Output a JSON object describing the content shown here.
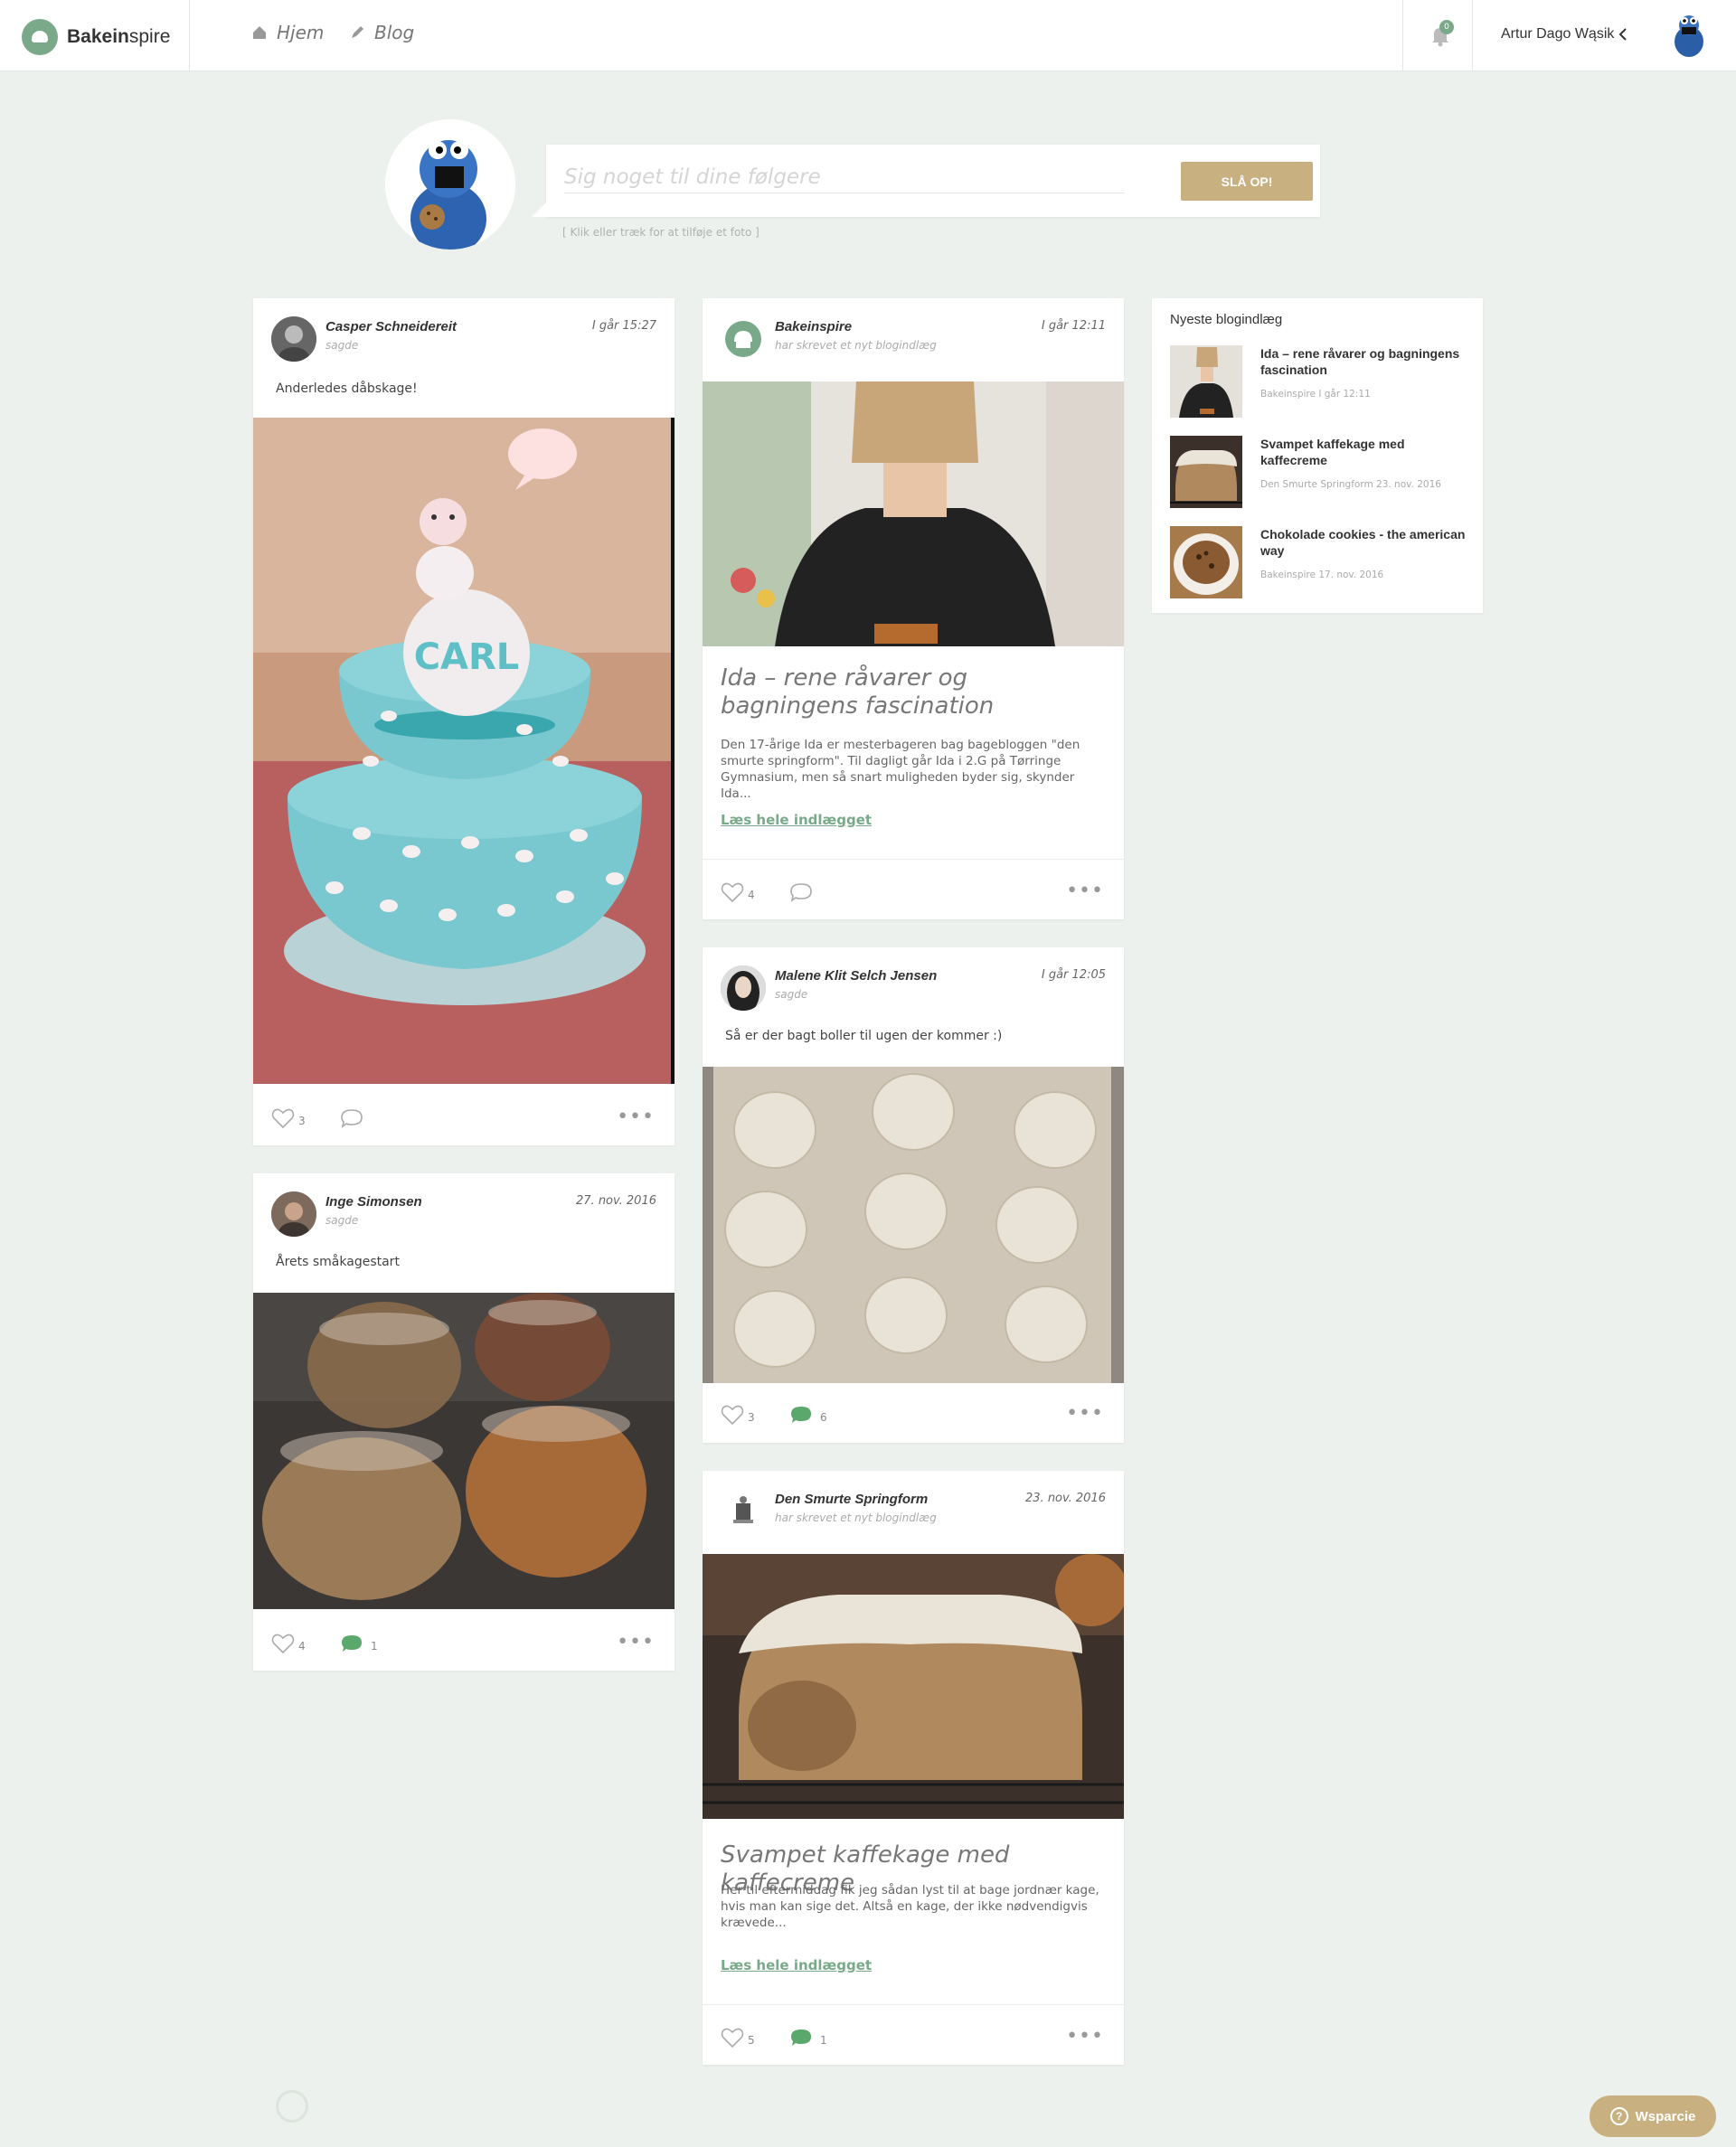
{
  "app": {
    "brand_bold": "Bakein",
    "brand_light": "spire"
  },
  "nav": {
    "home": "Hjem",
    "blog": "Blog"
  },
  "notifications": {
    "count": "0"
  },
  "user": {
    "name": "Artur Dago Wąsik"
  },
  "composer": {
    "placeholder": "Sig noget til dine følgere",
    "button": "SLÅ OP!",
    "hint": "[ Klik eller træk for at tilføje et foto ]"
  },
  "posts": [
    {
      "author": "Casper Schneidereit",
      "action": "sagde",
      "time": "I går 15:27",
      "text": "Anderledes dåbskage!",
      "likes": "3",
      "comments": ""
    },
    {
      "author": "Inge Simonsen",
      "action": "sagde",
      "time": "27. nov. 2016",
      "text": "Årets småkagestart",
      "likes": "4",
      "comments": "1"
    },
    {
      "author": "Bakeinspire",
      "action": "har skrevet et nyt blogindlæg",
      "time": "I går 12:11",
      "title": "Ida – rene råvarer og bagningens fascination",
      "excerpt": "Den 17-årige Ida er mesterbageren bag bagebloggen \"den smurte springform\". Til dagligt går Ida i 2.G på Tørringe Gymnasium, men så snart muligheden byder sig, skynder Ida...",
      "read_more": "Læs hele indlægget",
      "likes": "4",
      "comments": ""
    },
    {
      "author": "Malene Klit Selch Jensen",
      "action": "sagde",
      "time": "I går 12:05",
      "text": "Så er der bagt boller til ugen der kommer :)",
      "likes": "3",
      "comments": "6"
    },
    {
      "author": "Den Smurte Springform",
      "action": "har skrevet et nyt blogindlæg",
      "time": "23. nov. 2016",
      "title": "Svampet kaffekage med kaffecreme",
      "excerpt": "Her til eftermiddag fik jeg sådan lyst til at bage jordnær kage, hvis man kan sige det. Altså en kage, der ikke nødvendigvis krævede...",
      "read_more": "Læs hele indlægget",
      "likes": "5",
      "comments": "1"
    }
  ],
  "sidebar": {
    "title": "Nyeste blogindlæg",
    "items": [
      {
        "title": "Ida – rene råvarer og bagningens fascination",
        "meta": "Bakeinspire I går 12:11"
      },
      {
        "title": "Svampet kaffekage med kaffecreme",
        "meta": "Den Smurte Springform 23. nov. 2016"
      },
      {
        "title": "Chokolade cookies - the american way",
        "meta": "Bakeinspire 17. nov. 2016"
      }
    ]
  },
  "support": {
    "label": "Wsparcie"
  },
  "colors": {
    "accent_green": "#7aa98a",
    "accent_gold": "#c9b081",
    "background": "#edf1ed"
  },
  "icons": [
    "home-icon",
    "pencil-icon",
    "bell-icon",
    "chevron-left-icon",
    "heart-icon",
    "comment-icon",
    "more-icon",
    "question-icon"
  ]
}
